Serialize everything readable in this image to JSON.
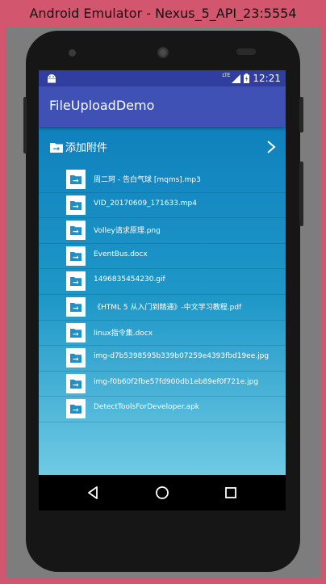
{
  "window": {
    "title": "Android Emulator - Nexus_5_API_23:5554"
  },
  "status_bar": {
    "time": "12:21",
    "network": "LTE"
  },
  "app": {
    "title": "FileUploadDemo"
  },
  "attach": {
    "label": "添加附件"
  },
  "files": [
    {
      "name": "周二珂 - 告白气球 [mqms].mp3"
    },
    {
      "name": "VID_20170609_171633.mp4"
    },
    {
      "name": "Volley请求原理.png"
    },
    {
      "name": "EventBus.docx"
    },
    {
      "name": "1496835454230.gif"
    },
    {
      "name": "《HTML 5 从入门到精通》-中文学习教程.pdf"
    },
    {
      "name": "linux指令集.docx"
    },
    {
      "name": "img-d7b5398595b339b07259e4393fbd19ee.jpg"
    },
    {
      "name": "img-f0b60f2fbe57fd900db1eb89ef0f721e.jpg"
    },
    {
      "name": "DetectToolsForDeveloper.apk"
    }
  ],
  "colors": {
    "status_bar": "#303f9f",
    "toolbar": "#3f51b5",
    "content_top": "#0f81bd",
    "content_bottom": "#6fcae4",
    "file_icon": "#1e8fc7"
  }
}
